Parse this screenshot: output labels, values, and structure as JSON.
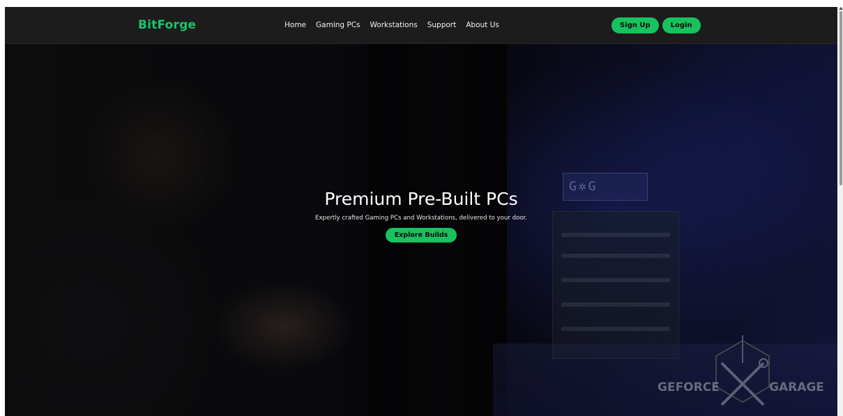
{
  "brand": {
    "name": "BitForge",
    "color": "#19c46a"
  },
  "nav": {
    "links": [
      "Home",
      "Gaming PCs",
      "Workstations",
      "Support",
      "About Us"
    ]
  },
  "auth": {
    "signup_label": "Sign Up",
    "login_label": "Login"
  },
  "hero": {
    "title": "Premium Pre-Built PCs",
    "subtitle": "Expertly crafted Gaming PCs and Workstations, delivered to your door.",
    "cta_label": "Explore Builds"
  },
  "watermark": {
    "text_left": "GEFORCE",
    "text_right": "GARAGE"
  },
  "colors": {
    "accent": "#17c25f",
    "navbar_bg": "#1c1c1c"
  },
  "icons": [
    "wrench-cross-logo-icon",
    "scroll-up-arrow-icon"
  ]
}
